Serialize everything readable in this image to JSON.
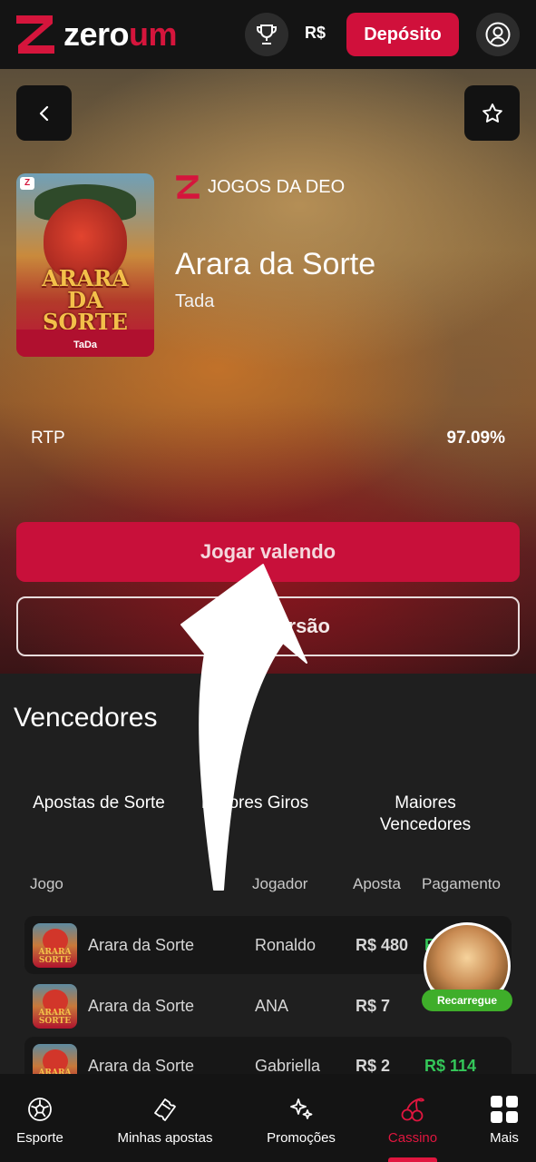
{
  "header": {
    "logo_white": "zero",
    "logo_red": "um",
    "currency": "R$",
    "deposit_label": "Depósito"
  },
  "game": {
    "provider_label": "JOGOS DA DEO",
    "title": "Arara da Sorte",
    "provider": "Tada",
    "thumb_title": "ARARA DA SORTE",
    "thumb_brand": "TaDa",
    "rtp_label": "RTP",
    "rtp_value": "97.09%",
    "play_real_label": "Jogar valendo",
    "play_demo_label": "Jogar versão"
  },
  "winners": {
    "title": "Vencedores",
    "tabs": [
      "Apostas de Sorte",
      "Maiores Giros",
      "Maiores Vencedores"
    ],
    "columns": [
      "Jogo",
      "Jogador",
      "Aposta",
      "Pagamento"
    ],
    "rows": [
      {
        "game": "Arara da Sorte",
        "player": "Ronaldo",
        "bet": "R$ 480",
        "payout": "R$"
      },
      {
        "game": "Arara da Sorte",
        "player": "ANA",
        "bet": "R$ 7",
        "payout": ""
      },
      {
        "game": "Arara da Sorte",
        "player": "Gabriella",
        "bet": "R$ 2",
        "payout": "R$ 114"
      }
    ]
  },
  "floating": {
    "recarregue_label": "Recarregue"
  },
  "nav": {
    "items": [
      "Esporte",
      "Minhas apostas",
      "Promoções",
      "Cassino",
      "Mais"
    ],
    "active": "Cassino"
  },
  "colors": {
    "brand_red": "#d0103b",
    "payout_green": "#34c759",
    "background": "#1e1e1e"
  }
}
